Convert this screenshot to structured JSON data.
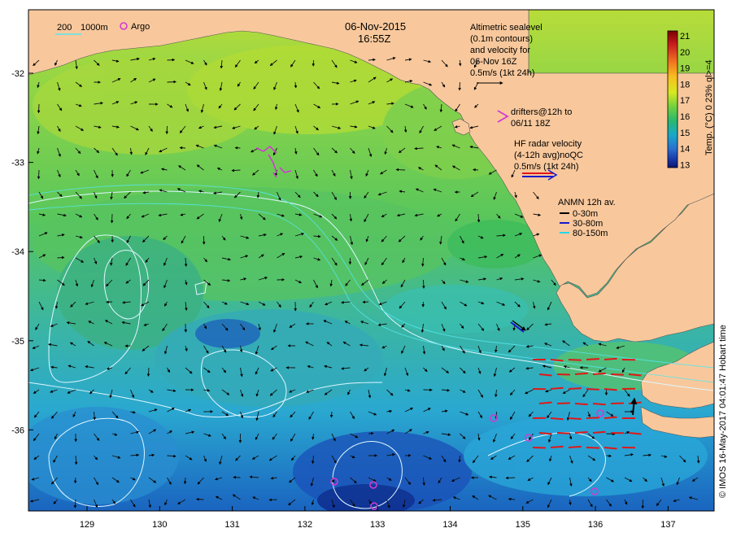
{
  "map": {
    "date": "06-Nov-2015",
    "time": "16:55Z",
    "credit": "© IMOS 16-May-2017 04:01:47 Hobart time",
    "scale": {
      "label_200": "200",
      "label_1000": "1000m"
    },
    "argo_label": "Argo",
    "altimetry": {
      "line1": "Altimetric sealevel",
      "line2": "(0.1m contours)",
      "line3": "and velocity for",
      "line4": "06-Nov 16Z",
      "line5": "0.5m/s (1kt 24h)"
    },
    "drifters": {
      "line1": "drifters@12h to",
      "line2": "06/11 18Z"
    },
    "hf_radar": {
      "line1": "HF radar velocity",
      "line2": "(4-12h avg)noQC",
      "line3": "0.5m/s (1kt 24h)"
    },
    "anmn": {
      "title": "ANMN 12h av.",
      "items": [
        {
          "label": "0-30m",
          "color": "#000000"
        },
        {
          "label": "30-80m",
          "color": "#1a1acc"
        },
        {
          "label": "80-150m",
          "color": "#22d8e8"
        }
      ]
    },
    "colorbar": {
      "title": "Temp. (°C) 0 23% ql>=4",
      "ticks": [
        "21",
        "20",
        "19",
        "18",
        "17",
        "16",
        "15",
        "14",
        "13"
      ],
      "colors": [
        "#7a0000",
        "#c81e1e",
        "#f07020",
        "#f7c020",
        "#d8e820",
        "#6cd040",
        "#28b870",
        "#1aa8c8",
        "#2a70d0",
        "#1838a8",
        "#0c1470"
      ]
    },
    "x_ticks": [
      "129",
      "130",
      "131",
      "132",
      "133",
      "134",
      "135",
      "136",
      "137"
    ],
    "y_ticks": [
      "-32",
      "-33",
      "-34",
      "-35",
      "-36"
    ],
    "colors": {
      "land": "#f8c89c",
      "ocean_mid": "#5fce5c",
      "contour": "#dff6ff",
      "isobath": "#57e6ee",
      "argo": "#d23ad2",
      "hf_arrow": "#e01818",
      "drifter": "#d23ad2"
    }
  }
}
